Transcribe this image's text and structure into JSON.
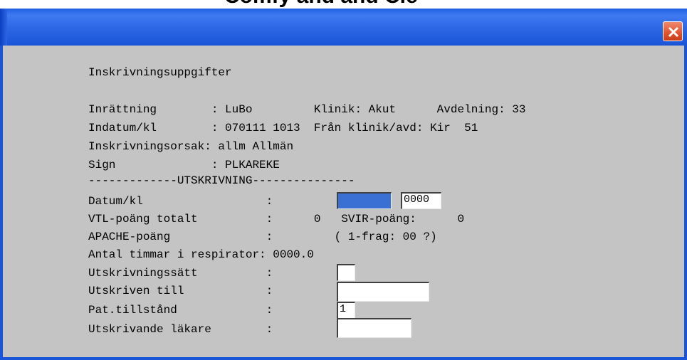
{
  "page_heading": "Comfy and and Cie",
  "window": {
    "close_icon": "close-icon"
  },
  "header": {
    "title": "Inskrivningsuppgifter",
    "line_inrattning": "Inrättning        : LuBo         Klinik: Akut      Avdelning: 33",
    "line_indatum": "Indatum/kl        : 070111 1013  Från klinik/avd: Kir  51",
    "line_orsak": "Inskrivningsorsak: allm Allmän",
    "line_sign": "Sign              : PLKAREKE",
    "separator": "-------------UTSKRIVNING---------------"
  },
  "form": {
    "datum_label": "Datum/kl                  :",
    "datum_value": "",
    "time_value": "0000",
    "vtl_line": "VTL-poäng totalt          :      0   SVIR-poäng:      0",
    "apache_line": "APACHE-poäng              :         ( 1-frag: 00 ?)",
    "respirator_line": "Antal timmar i respirator: 0000.0",
    "utskrivningssatt_label": "Utskrivningssätt          :",
    "utskrivningssatt_value": "",
    "utskriven_till_label": "Utskriven till            :",
    "utskriven_till_value": "",
    "pat_tillstand_label": "Pat.tillstånd             :",
    "pat_tillstand_value": "1",
    "utskrivande_lakare_label": "Utskrivande läkare        :",
    "utskrivande_lakare_value": ""
  },
  "colors": {
    "titlebar": "#2c66e4",
    "body": "#c4c4c4",
    "close_button": "#e0532e",
    "selection": "#3a6fd4"
  }
}
